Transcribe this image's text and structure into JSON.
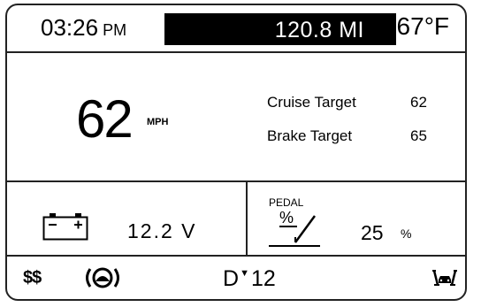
{
  "header": {
    "time": "03:26",
    "ampm": "PM",
    "odometer": "120.8 MI",
    "temperature": "67°F"
  },
  "speed": {
    "value": "62",
    "unit": "MPH"
  },
  "targets": [
    {
      "label": "Cruise Target",
      "value": "62"
    },
    {
      "label": "Brake Target",
      "value": "65"
    }
  ],
  "battery": {
    "icon": "battery-icon",
    "voltage": "12.2 V"
  },
  "pedal": {
    "label": "PEDAL",
    "icon": "pedal-percent-icon",
    "symbol": "%",
    "value": "25",
    "unit": "%"
  },
  "status": {
    "dollars": "$$",
    "brake_icon": "brake-warning-icon",
    "gear": "D",
    "gear_arrow": "▼",
    "gear_number": "12",
    "lane_icon": "lane-assist-icon"
  }
}
